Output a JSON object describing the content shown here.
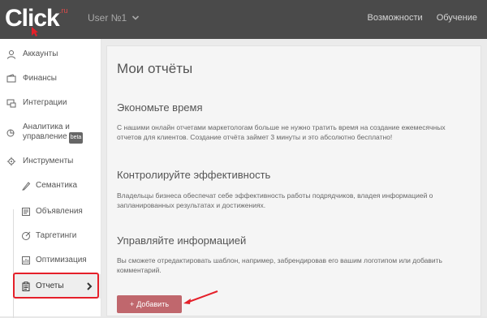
{
  "brand": {
    "name": "Click",
    "suffix": ".ru"
  },
  "header": {
    "user_label": "User №1",
    "nav": [
      {
        "label": "Возможности"
      },
      {
        "label": "Обучение"
      }
    ]
  },
  "sidebar": {
    "items": [
      {
        "label": "Аккаунты",
        "icon": "user-icon"
      },
      {
        "label": "Финансы",
        "icon": "wallet-icon"
      },
      {
        "label": "Интеграции",
        "icon": "integration-icon"
      },
      {
        "label": "Аналитика и управление",
        "icon": "analytics-icon",
        "badge": "beta"
      },
      {
        "label": "Инструменты",
        "icon": "gear-icon"
      }
    ],
    "subitems": [
      {
        "label": "Семантика",
        "icon": "semantics-icon"
      },
      {
        "label": "Объявления",
        "icon": "ads-icon"
      },
      {
        "label": "Таргетинги",
        "icon": "target-icon"
      },
      {
        "label": "Оптимизация",
        "icon": "chart-icon"
      },
      {
        "label": "Отчеты",
        "icon": "clipboard-icon",
        "active": true
      }
    ]
  },
  "main": {
    "title": "Мои отчёты",
    "sections": [
      {
        "heading": "Экономьте время",
        "text": "С нашими онлайн отчетами маркетологам больше не нужно тратить время на создание ежемесячных отчетов для клиентов. Создание отчёта займет 3 минуты и это абсолютно бесплатно!"
      },
      {
        "heading": "Контролируйте эффективность",
        "text": "Владельцы бизнеса обеспечат себе эффективность работы подрядчиков, владея информацией о запланированных результатах и достижениях."
      },
      {
        "heading": "Управляйте информацией",
        "text": "Вы сможете отредактировать шаблон, например, забрендировав его вашим логотипом или добавить комментарий."
      }
    ],
    "add_button": "Добавить"
  },
  "colors": {
    "topbar": "#4a4a4a",
    "accent": "#c0676d",
    "highlight": "#e5202a"
  }
}
